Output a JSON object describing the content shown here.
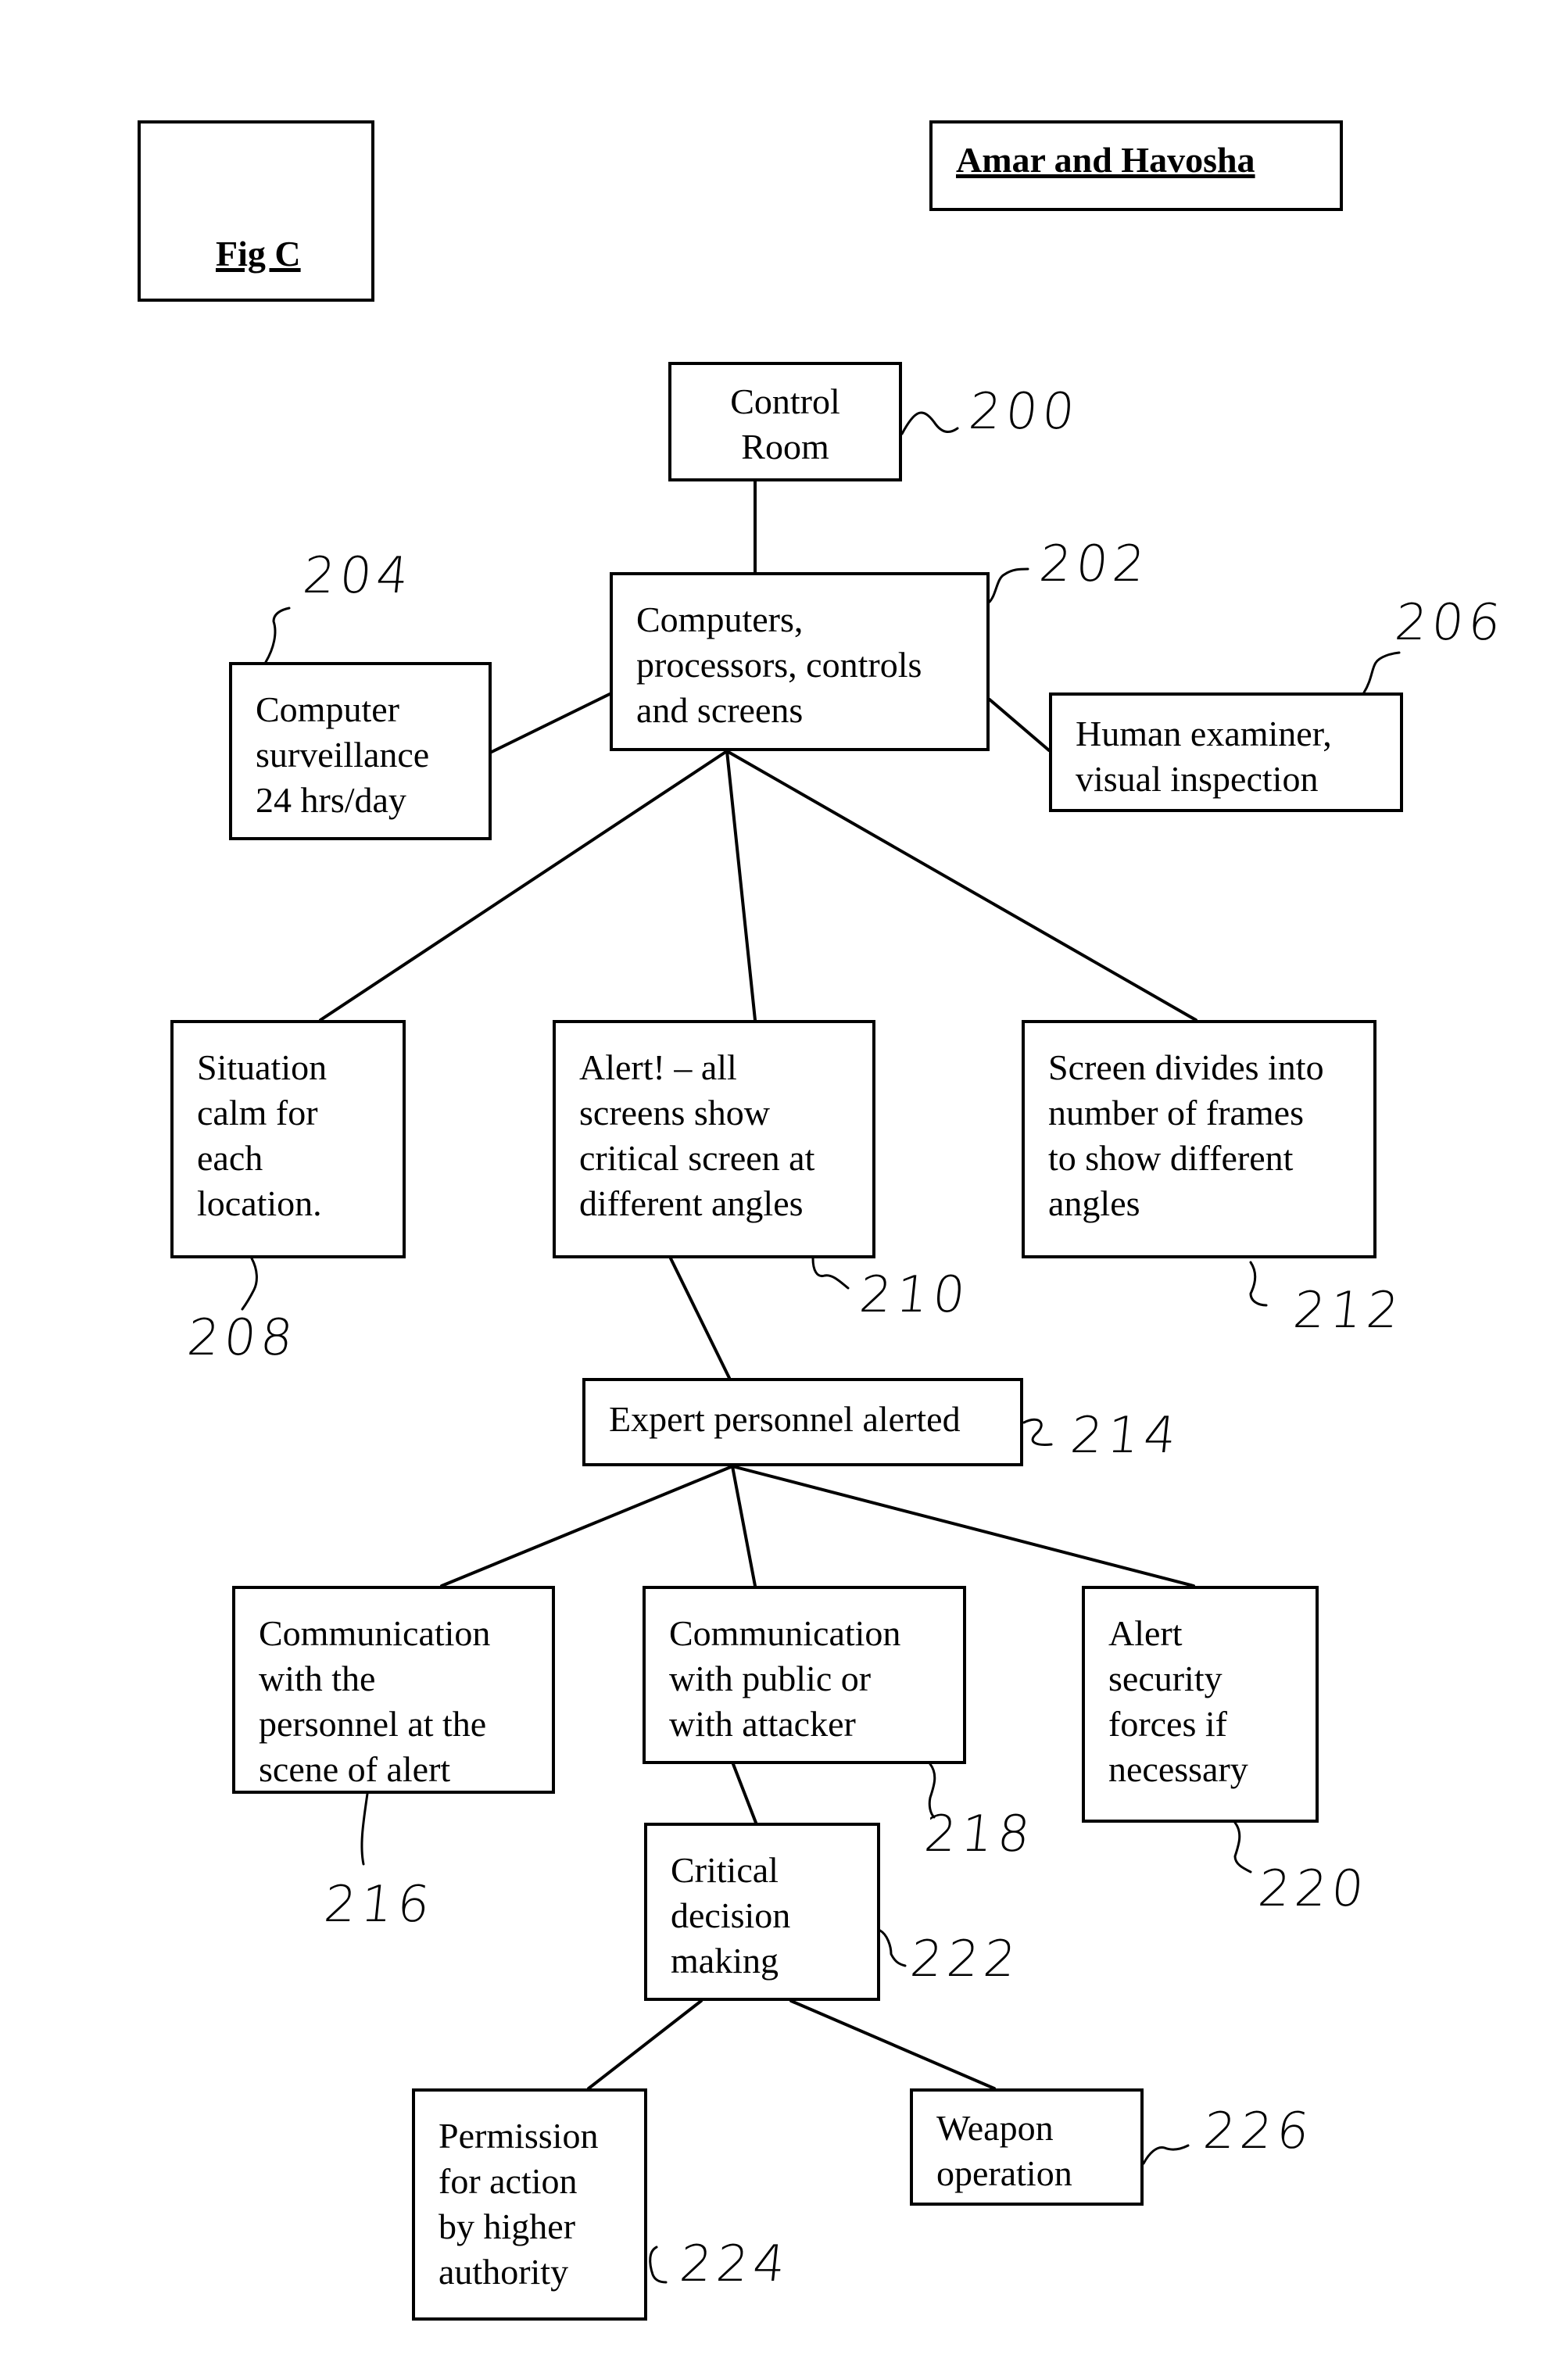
{
  "header": {
    "figure_label": "Fig C",
    "authors": "Amar and Havosha"
  },
  "nodes": {
    "n200": {
      "text": "Control\nRoom",
      "ref": "200"
    },
    "n202": {
      "text": "Computers,\nprocessors, controls\nand screens",
      "ref": "202"
    },
    "n204": {
      "text": "Computer\nsurveillance\n24 hrs/day",
      "ref": "204"
    },
    "n206": {
      "text": "Human examiner,\nvisual inspection",
      "ref": "206"
    },
    "n208": {
      "text": "Situation\ncalm for\neach\nlocation.",
      "ref": "208"
    },
    "n210": {
      "text": "Alert! – all\nscreens show\ncritical screen at\ndifferent angles",
      "ref": "210"
    },
    "n212": {
      "text": "Screen divides into\nnumber of frames\nto show different\nangles",
      "ref": "212"
    },
    "n214": {
      "text": "Expert personnel alerted",
      "ref": "214"
    },
    "n216": {
      "text": "Communication\nwith the\npersonnel at the\nscene of alert",
      "ref": "216"
    },
    "n218": {
      "text": "Communication\nwith public or\nwith attacker",
      "ref": "218"
    },
    "n220": {
      "text": "Alert\nsecurity\nforces if\nnecessary",
      "ref": "220"
    },
    "n222": {
      "text": "Critical\ndecision\nmaking",
      "ref": "222"
    },
    "n224": {
      "text": "Permission\nfor action\nby higher\nauthority",
      "ref": "224"
    },
    "n226": {
      "text": "Weapon\noperation",
      "ref": "226"
    }
  },
  "edges": [
    [
      "200",
      "202"
    ],
    [
      "202",
      "204"
    ],
    [
      "202",
      "206"
    ],
    [
      "202",
      "208"
    ],
    [
      "202",
      "210"
    ],
    [
      "202",
      "212"
    ],
    [
      "210",
      "214"
    ],
    [
      "214",
      "216"
    ],
    [
      "214",
      "218"
    ],
    [
      "214",
      "220"
    ],
    [
      "218",
      "222"
    ],
    [
      "222",
      "224"
    ],
    [
      "222",
      "226"
    ]
  ]
}
